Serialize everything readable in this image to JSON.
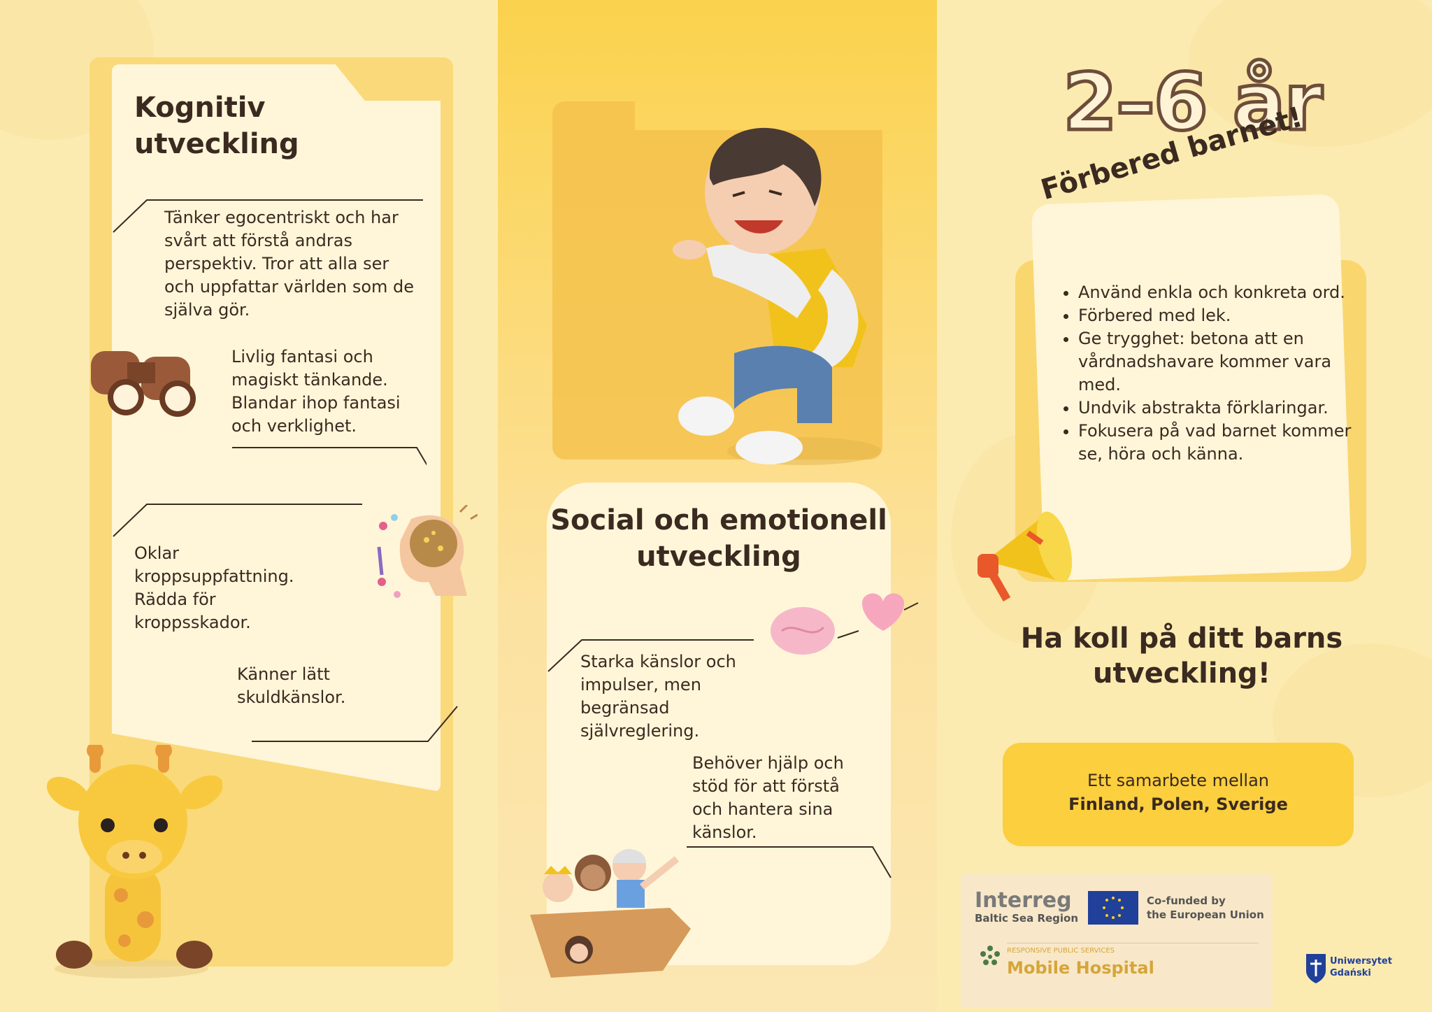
{
  "left": {
    "title_line1": "Kognitiv",
    "title_line2": "utveckling",
    "p1": [
      "Tänker egocentriskt och har",
      "svårt att förstå andras",
      "perspektiv. Tror att alla ser",
      "och uppfattar världen som de",
      "själva gör."
    ],
    "p2": [
      "Livlig fantasi och",
      "magiskt tänkande.",
      "Blandar ihop fantasi",
      "och verklighet."
    ],
    "p3": [
      "Oklar",
      "kroppsuppfattning.",
      "Rädda för",
      "kroppsskador."
    ],
    "p4": [
      "Känner lätt",
      "skuldkänslor."
    ]
  },
  "middle": {
    "title_line1": "Social och emotionell",
    "title_line2": "utveckling",
    "p1": [
      "Starka känslor och",
      "impulser, men",
      "begränsad",
      "självreglering."
    ],
    "p2": [
      "Behöver hjälp och",
      "stöd för att förstå",
      "och hantera sina",
      "känslor."
    ]
  },
  "right": {
    "age": "2–6 år",
    "prep_title": "Förbered barnet!",
    "prep_items": [
      "Använd enkla och konkreta ord.",
      "Förbered med lek.",
      "Ge trygghet: betona att en vårdnadshavare kommer vara med.",
      "Undvik abstrakta förklaringar.",
      "Fokusera på vad barnet kommer se, höra och känna."
    ],
    "watch_line1": "Ha koll på ditt barns",
    "watch_line2": "utveckling!",
    "collab_line1": "Ett samarbete mellan",
    "collab_line2": "Finland, Polen, Sverige"
  },
  "logos": {
    "interreg": "Interreg",
    "baltic": "Baltic Sea Region",
    "cofunded_line1": "Co-funded by",
    "cofunded_line2": "the European Union",
    "rps": "RESPONSIVE PUBLIC SERVICES",
    "mobile_hospital": "Mobile Hospital",
    "ug_line1": "Uniwersytet",
    "ug_line2": "Gdański"
  },
  "colors": {
    "background": "#fcebb0",
    "card": "#fff6d9",
    "accent_yellow": "#fbcf3e",
    "text_brown": "#3a2a20"
  },
  "icons": [
    "binoculars-icon",
    "brain-head-icon",
    "boy-3d-figure",
    "brain-heart-icon",
    "kids-in-box-icon",
    "giraffe-toy-icon",
    "megaphone-icon",
    "eu-flag-icon",
    "mobile-hospital-logo-icon",
    "ug-crest-icon"
  ]
}
